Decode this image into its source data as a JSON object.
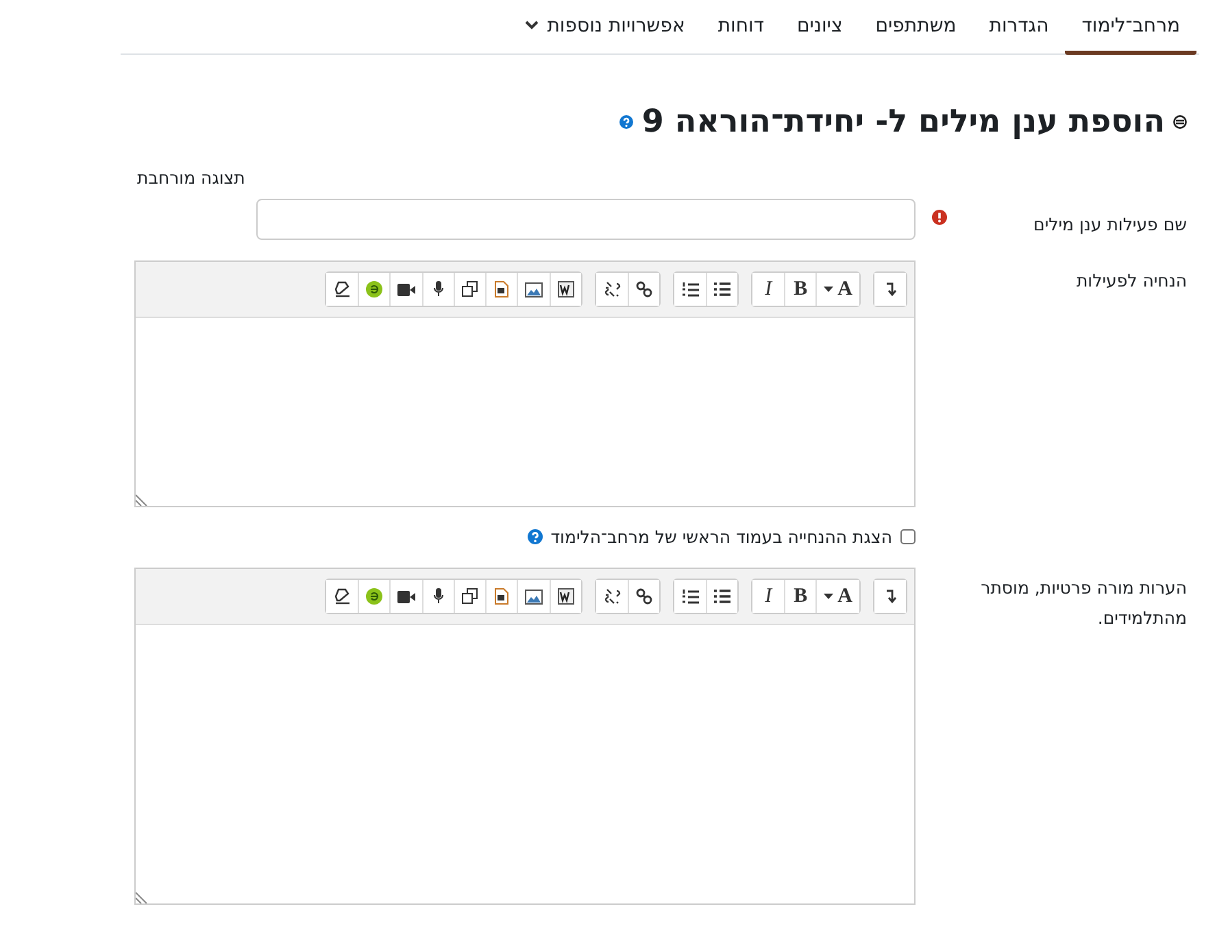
{
  "tabs": [
    {
      "label": "מרחב־לימוד",
      "selected": true,
      "dropdown": false
    },
    {
      "label": "הגדרות",
      "selected": false,
      "dropdown": false
    },
    {
      "label": "משתתפים",
      "selected": false,
      "dropdown": false
    },
    {
      "label": "ציונים",
      "selected": false,
      "dropdown": false
    },
    {
      "label": "דוחות",
      "selected": false,
      "dropdown": false
    },
    {
      "label": "אפשרויות נוספות",
      "selected": false,
      "dropdown": true
    }
  ],
  "heading": "הוספת ענן מילים ל- יחידת־הוראה 9",
  "expand_link": "תצוגה מורחבת",
  "name_field": {
    "label": "שם פעילות ענן מילים",
    "required": true
  },
  "editors": [
    {
      "label": "הנחיה לפעילות",
      "toolbar": [
        [
          {
            "kind": "collapse"
          }
        ],
        [
          {
            "kind": "font",
            "label": "A"
          },
          {
            "kind": "bold",
            "label": "B"
          },
          {
            "kind": "italic",
            "label": "I"
          }
        ],
        [
          {
            "kind": "bullets"
          },
          {
            "kind": "numbers"
          }
        ],
        [
          {
            "kind": "link"
          },
          {
            "kind": "unlink"
          }
        ],
        [
          {
            "kind": "word"
          },
          {
            "kind": "image"
          },
          {
            "kind": "media"
          },
          {
            "kind": "copy"
          },
          {
            "kind": "mic"
          },
          {
            "kind": "video"
          },
          {
            "kind": "green"
          },
          {
            "kind": "eraser"
          }
        ]
      ],
      "checkbox": {
        "label": "הצגת ההנחייה בעמוד הראשי של מרחב־הלימוד",
        "checked": false
      }
    },
    {
      "label": "הערות מורה פרטיות, מוסתר מהתלמידים.",
      "toolbar": [
        [
          {
            "kind": "collapse"
          }
        ],
        [
          {
            "kind": "font",
            "label": "A"
          },
          {
            "kind": "bold",
            "label": "B"
          },
          {
            "kind": "italic",
            "label": "I"
          }
        ],
        [
          {
            "kind": "bullets"
          },
          {
            "kind": "numbers"
          }
        ],
        [
          {
            "kind": "link"
          },
          {
            "kind": "unlink"
          }
        ],
        [
          {
            "kind": "word"
          },
          {
            "kind": "image"
          },
          {
            "kind": "media"
          },
          {
            "kind": "copy"
          },
          {
            "kind": "mic"
          },
          {
            "kind": "video"
          },
          {
            "kind": "green"
          },
          {
            "kind": "eraser"
          }
        ]
      ]
    }
  ]
}
